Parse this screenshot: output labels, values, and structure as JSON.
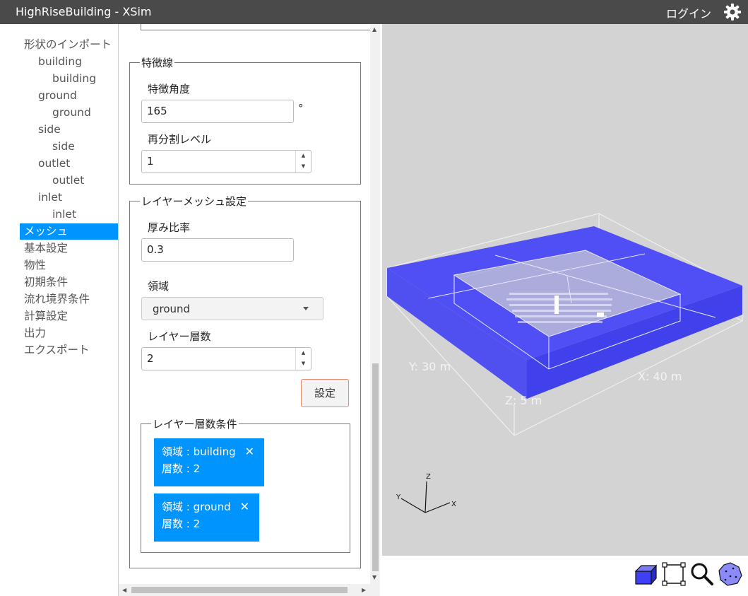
{
  "window": {
    "title": "HighRiseBuilding - XSim",
    "login_label": "ログイン"
  },
  "nav": {
    "items": [
      {
        "label": "形状のインポート",
        "level": 0
      },
      {
        "label": "building",
        "level": 1
      },
      {
        "label": "building",
        "level": 2
      },
      {
        "label": "ground",
        "level": 1
      },
      {
        "label": "ground",
        "level": 2
      },
      {
        "label": "side",
        "level": 1
      },
      {
        "label": "side",
        "level": 2
      },
      {
        "label": "outlet",
        "level": 1
      },
      {
        "label": "outlet",
        "level": 2
      },
      {
        "label": "inlet",
        "level": 1
      },
      {
        "label": "inlet",
        "level": 2
      },
      {
        "label": "メッシュ",
        "level": 0,
        "active": true
      },
      {
        "label": "基本設定",
        "level": 0
      },
      {
        "label": "物性",
        "level": 0
      },
      {
        "label": "初期条件",
        "level": 0
      },
      {
        "label": "流れ境界条件",
        "level": 0
      },
      {
        "label": "計算設定",
        "level": 0
      },
      {
        "label": "出力",
        "level": 0
      },
      {
        "label": "エクスポート",
        "level": 0
      }
    ]
  },
  "feature": {
    "legend": "特徴線",
    "angle_label": "特徴角度",
    "angle_value": "165",
    "angle_unit": "°",
    "refine_label": "再分割レベル",
    "refine_value": "1"
  },
  "layer": {
    "legend": "レイヤーメッシュ設定",
    "thickness_label": "厚み比率",
    "thickness_value": "0.3",
    "region_label": "領域",
    "region_value": "ground",
    "count_label": "レイヤー層数",
    "count_value": "2",
    "set_label": "設定",
    "conditions_legend": "レイヤー層数条件",
    "conditions": [
      {
        "region_text": "領域 : building",
        "count_text": "層数 : 2"
      },
      {
        "region_text": "領域 : ground",
        "count_text": "層数 : 2"
      }
    ]
  },
  "viewer": {
    "dim_y": "Y: 30 m",
    "dim_x": "X: 40 m",
    "dim_z": "Z: 5 m",
    "axis_z": "Z",
    "axis_y": "Y",
    "axis_x": "X",
    "colors": {
      "background": "#d3d3d3",
      "domain": "#3f3ff5"
    }
  },
  "toolbar": {
    "icons": [
      "solid-view-icon",
      "fit-view-icon",
      "zoom-icon",
      "rotate-view-icon"
    ]
  },
  "colors": {
    "accent": "#0094ff",
    "titlebar": "#4a4a4a"
  }
}
